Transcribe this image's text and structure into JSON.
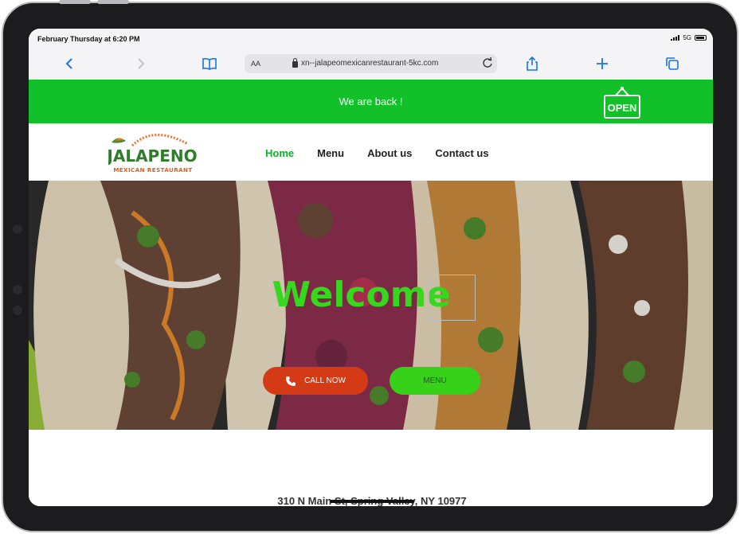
{
  "status_bar": {
    "time": "February Thursday at 6:20 PM",
    "network": "5G"
  },
  "toolbar": {
    "back_icon": "chevron-left-icon",
    "forward_icon": "chevron-right-icon",
    "bookmarks_icon": "book-icon",
    "text_size": "AA",
    "url": "xn--jalapeomexicanrestaurant-5kc.com",
    "reload_icon": "reload-icon",
    "share_icon": "share-icon",
    "new_tab_icon": "plus-icon",
    "tabs_icon": "tabs-icon"
  },
  "banner": {
    "text": "We are back !",
    "sign_text": "OPEN"
  },
  "logo": {
    "name": "JALAPENO",
    "tagline": "MEXICAN RESTAURANT"
  },
  "nav": {
    "items": [
      "Home",
      "Menu",
      "About us",
      "Contact us"
    ],
    "active": "Home"
  },
  "hero": {
    "title": "Welcome",
    "call_button": "CALL NOW",
    "menu_button": "MENU"
  },
  "footer": {
    "address": "310 N Main St, Spring Valley, NY 10977"
  },
  "colors": {
    "brand_green": "#12c12a",
    "call_red": "#d53a17",
    "menu_green": "#37d11a",
    "safari_blue": "#1a73e8"
  }
}
